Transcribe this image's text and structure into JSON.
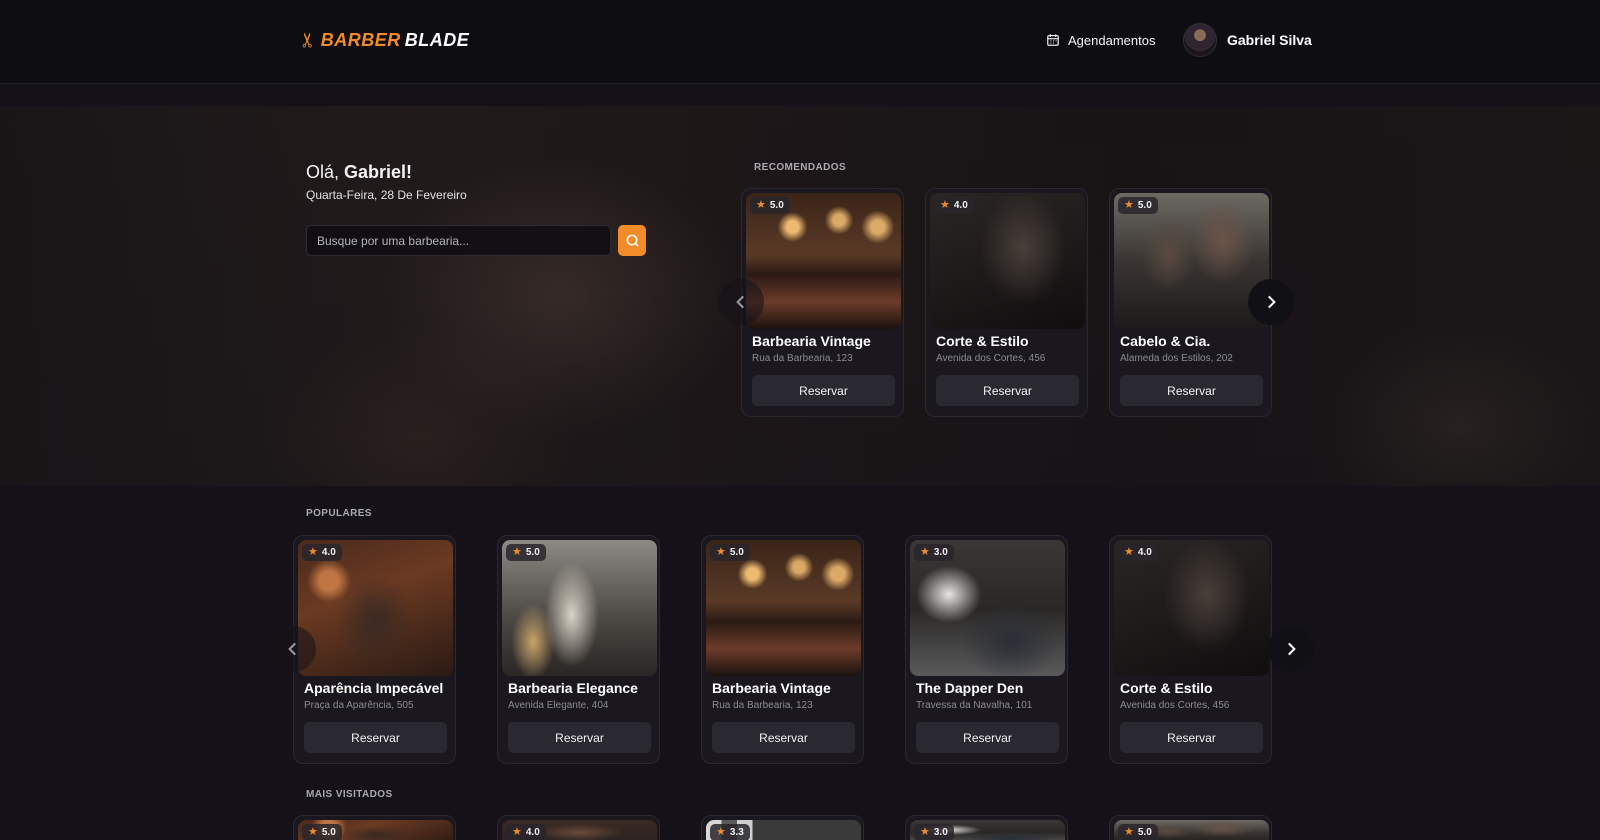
{
  "header": {
    "logo": {
      "part1": "BARBER",
      "part2": "BLADE",
      "icon": "scissors-icon"
    },
    "appointments_label": "Agendamentos",
    "user_name": "Gabriel Silva"
  },
  "hero": {
    "greeting_prefix": "Olá,",
    "greeting_name": "Gabriel!",
    "date": "Quarta-Feira, 28 De Fevereiro",
    "search_placeholder": "Busque por uma barbearia..."
  },
  "colors": {
    "accent": "#f28c28",
    "background": "#141218",
    "card": "#1a181e"
  },
  "recommended": {
    "title": "RECOMENDADOS",
    "items": [
      {
        "name": "Barbearia Vintage",
        "address": "Rua da Barbearia, 123",
        "rating": "5.0",
        "button": "Reservar"
      },
      {
        "name": "Corte & Estilo",
        "address": "Avenida dos Cortes, 456",
        "rating": "4.0",
        "button": "Reservar"
      },
      {
        "name": "Cabelo & Cia.",
        "address": "Alameda dos Estilos, 202",
        "rating": "5.0",
        "button": "Reservar"
      }
    ]
  },
  "popular": {
    "title": "POPULARES",
    "items": [
      {
        "name": "Aparência Impecável",
        "address": "Praça da Aparência, 505",
        "rating": "4.0",
        "button": "Reservar"
      },
      {
        "name": "Barbearia Elegance",
        "address": "Avenida Elegante, 404",
        "rating": "5.0",
        "button": "Reservar"
      },
      {
        "name": "Barbearia Vintage",
        "address": "Rua da Barbearia, 123",
        "rating": "5.0",
        "button": "Reservar"
      },
      {
        "name": "The Dapper Den",
        "address": "Travessa da Navalha, 101",
        "rating": "3.0",
        "button": "Reservar"
      },
      {
        "name": "Corte & Estilo",
        "address": "Avenida dos Cortes, 456",
        "rating": "4.0",
        "button": "Reservar"
      }
    ]
  },
  "most_visited": {
    "title": "MAIS VISITADOS",
    "items": [
      {
        "rating": "5.0"
      },
      {
        "rating": "4.0"
      },
      {
        "rating": "3.3"
      },
      {
        "rating": "3.0"
      },
      {
        "rating": "5.0"
      }
    ]
  }
}
